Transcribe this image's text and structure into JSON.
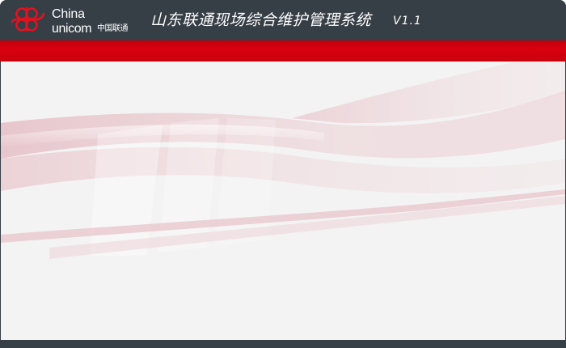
{
  "brand": {
    "logo_line1": "China",
    "logo_line2": "unicom",
    "logo_cn": "中国联通",
    "logo_color": "#d8000f"
  },
  "window": {
    "title": "山东联通现场综合维护管理系统",
    "version": "V1.1"
  },
  "colors": {
    "titlebar": "#363e46",
    "accent_bar": "#d8000f",
    "content_bg": "#f3f3f3",
    "wave": "#d9a5ae"
  }
}
